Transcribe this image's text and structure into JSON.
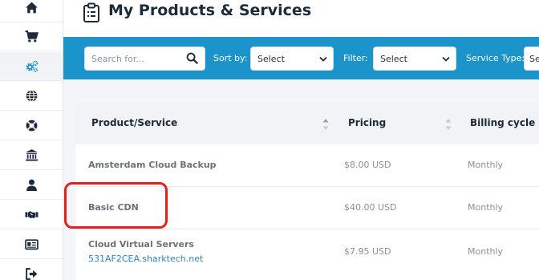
{
  "sidebar": {
    "items": [
      {
        "icon": "home-icon"
      },
      {
        "icon": "cart-icon"
      },
      {
        "icon": "cogs-icon",
        "active": true
      },
      {
        "icon": "globe-icon"
      },
      {
        "icon": "lifebuoy-icon"
      },
      {
        "icon": "bank-icon"
      },
      {
        "icon": "user-icon"
      },
      {
        "icon": "handshake-icon"
      },
      {
        "icon": "id-card-icon"
      },
      {
        "icon": "sign-out-icon"
      }
    ]
  },
  "header": {
    "title": "My Products & Services",
    "title_icon": "clipboard-icon"
  },
  "filters": {
    "search_placeholder": "Search for...",
    "sort_label": "Sort by:",
    "sort_value": "Select",
    "filter_label": "Filter:",
    "filter_value": "Select",
    "service_type_label": "Service Type:",
    "service_type_value": "Se"
  },
  "table": {
    "columns": [
      "Product/Service",
      "Pricing",
      "Billing cycle"
    ],
    "rows": [
      {
        "name": "Amsterdam Cloud Backup",
        "subtitle": "",
        "pricing": "$8.00 USD",
        "cycle": "Monthly"
      },
      {
        "name": "Basic CDN",
        "subtitle": "",
        "pricing": "$40.00 USD",
        "cycle": "Monthly"
      },
      {
        "name": "Cloud Virtual Servers",
        "subtitle": "531AF2CEA.sharktech.net",
        "pricing": "$7.95 USD",
        "cycle": "Monthly"
      }
    ]
  },
  "colors": {
    "accent": "#1b94cc",
    "highlight": "#e2211c",
    "link": "#2a86c7"
  }
}
